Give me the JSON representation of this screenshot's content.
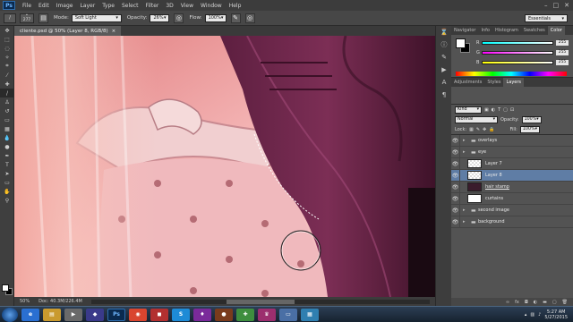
{
  "menu": {
    "logo": "Ps",
    "items": [
      "File",
      "Edit",
      "Image",
      "Layer",
      "Type",
      "Select",
      "Filter",
      "3D",
      "View",
      "Window",
      "Help"
    ]
  },
  "options": {
    "brush_size": "277",
    "mode_label": "Mode:",
    "mode_value": "Soft Light",
    "opacity_label": "Opacity:",
    "opacity_value": "26%",
    "flow_label": "Flow:",
    "flow_value": "100%"
  },
  "workspace": "Essentials",
  "document": {
    "tab_title": "cliente.psd @ 50% (Layer 8, RGB/8)",
    "zoom": "50%",
    "doc_size": "Doc: 40.3M/226.4M"
  },
  "color_panel": {
    "tabs": [
      "Navigator",
      "Info",
      "Histogram",
      "Swatches",
      "Color"
    ],
    "active_tab": "Color",
    "r": "255",
    "g": "255",
    "b": "255"
  },
  "adj_panel": {
    "tabs": [
      "Adjustments",
      "Styles",
      "Layers"
    ],
    "active_tab": "Layers"
  },
  "layers_panel": {
    "kind_label": "Kind",
    "blend_mode": "Normal",
    "opacity_label": "Opacity:",
    "opacity_value": "100%",
    "lock_label": "Lock:",
    "fill_label": "Fill:",
    "fill_value": "100%",
    "layers": [
      {
        "name": "overlays",
        "type": "group"
      },
      {
        "name": "eye",
        "type": "group"
      },
      {
        "name": "Layer 7",
        "type": "layer"
      },
      {
        "name": "Layer 8",
        "type": "layer"
      },
      {
        "name": "hair stamp",
        "type": "layer"
      },
      {
        "name": "curtains",
        "type": "layer"
      },
      {
        "name": "second image",
        "type": "group"
      },
      {
        "name": "background",
        "type": "group"
      }
    ],
    "selected_layer": "Layer 8"
  },
  "taskbar": {
    "time": "5:27 AM",
    "date": "5/27/2015",
    "ps_label": "Ps"
  },
  "colors": {
    "selected_layer": "#5f7da5",
    "panel_bg": "#535353",
    "accent_red": "#c0323d"
  }
}
